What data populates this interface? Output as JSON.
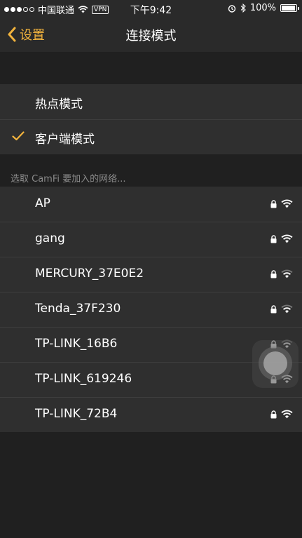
{
  "status_bar": {
    "carrier": "中国联通",
    "vpn": "VPN",
    "time": "下午9:42",
    "battery": "100%",
    "icons": [
      "signal-dots-icon",
      "wifi-icon",
      "alarm-icon",
      "bluetooth-icon",
      "battery-icon"
    ]
  },
  "nav": {
    "back_label": "设置",
    "title": "连接模式"
  },
  "modes": [
    {
      "label": "热点模式",
      "selected": false
    },
    {
      "label": "客户端模式",
      "selected": true
    }
  ],
  "networks_header": "选取 CamFi 要加入的网络...",
  "networks": [
    {
      "ssid": "AP",
      "locked": true,
      "signal": "full"
    },
    {
      "ssid": "gang",
      "locked": true,
      "signal": "full"
    },
    {
      "ssid": "MERCURY_37E0E2",
      "locked": true,
      "signal": "medium"
    },
    {
      "ssid": "Tenda_37F230",
      "locked": true,
      "signal": "medium"
    },
    {
      "ssid": "TP-LINK_16B6",
      "locked": true,
      "signal": "medium"
    },
    {
      "ssid": "TP-LINK_619246",
      "locked": true,
      "signal": "full"
    },
    {
      "ssid": "TP-LINK_72B4",
      "locked": true,
      "signal": "full"
    }
  ],
  "colors": {
    "accent": "#f2b33d",
    "background": "#202020",
    "cell": "#2f2f2f",
    "bar": "#2a2a2a"
  }
}
